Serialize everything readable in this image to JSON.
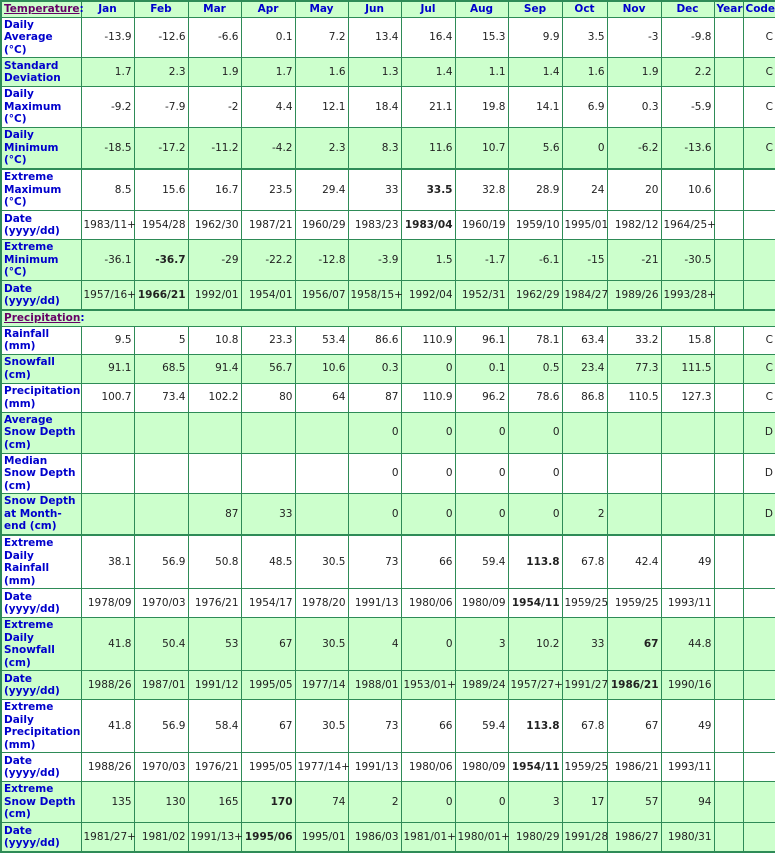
{
  "header": {
    "section_label": "Temperature",
    "months": [
      "Jan",
      "Feb",
      "Mar",
      "Apr",
      "May",
      "Jun",
      "Jul",
      "Aug",
      "Sep",
      "Oct",
      "Nov",
      "Dec"
    ],
    "year_label": "Year",
    "code_label": "Code"
  },
  "precip_section_label": "Precipitation",
  "temperature_rows": [
    {
      "label": "Daily Average (°C)",
      "values": [
        "-13.9",
        "-12.6",
        "-6.6",
        "0.1",
        "7.2",
        "13.4",
        "16.4",
        "15.3",
        "9.9",
        "3.5",
        "-3",
        "-9.8"
      ],
      "year": "",
      "code": "C",
      "bold": []
    },
    {
      "label": "Standard Deviation",
      "values": [
        "1.7",
        "2.3",
        "1.9",
        "1.7",
        "1.6",
        "1.3",
        "1.4",
        "1.1",
        "1.4",
        "1.6",
        "1.9",
        "2.2"
      ],
      "year": "",
      "code": "C",
      "bold": []
    },
    {
      "label": "Daily Maximum (°C)",
      "values": [
        "-9.2",
        "-7.9",
        "-2",
        "4.4",
        "12.1",
        "18.4",
        "21.1",
        "19.8",
        "14.1",
        "6.9",
        "0.3",
        "-5.9"
      ],
      "year": "",
      "code": "C",
      "bold": []
    },
    {
      "label": "Daily Minimum (°C)",
      "values": [
        "-18.5",
        "-17.2",
        "-11.2",
        "-4.2",
        "2.3",
        "8.3",
        "11.6",
        "10.7",
        "5.6",
        "0",
        "-6.2",
        "-13.6"
      ],
      "year": "",
      "code": "C",
      "bold": []
    },
    {
      "label": "Extreme Maximum (°C)",
      "values": [
        "8.5",
        "15.6",
        "16.7",
        "23.5",
        "29.4",
        "33",
        "33.5",
        "32.8",
        "28.9",
        "24",
        "20",
        "10.6"
      ],
      "year": "",
      "code": "",
      "bold": [
        6
      ]
    },
    {
      "label": "Date (yyyy/dd)",
      "values": [
        "1983/11+",
        "1954/28",
        "1962/30",
        "1987/21",
        "1960/29",
        "1983/23",
        "1983/04",
        "1960/19",
        "1959/10",
        "1995/01",
        "1982/12",
        "1964/25+"
      ],
      "year": "",
      "code": "",
      "bold": [
        6
      ]
    },
    {
      "label": "Extreme Minimum (°C)",
      "values": [
        "-36.1",
        "-36.7",
        "-29",
        "-22.2",
        "-12.8",
        "-3.9",
        "1.5",
        "-1.7",
        "-6.1",
        "-15",
        "-21",
        "-30.5"
      ],
      "year": "",
      "code": "",
      "bold": [
        1
      ]
    },
    {
      "label": "Date (yyyy/dd)",
      "values": [
        "1957/16+",
        "1966/21",
        "1992/01",
        "1954/01",
        "1956/07",
        "1958/15+",
        "1992/04",
        "1952/31",
        "1962/29",
        "1984/27",
        "1989/26",
        "1993/28+"
      ],
      "year": "",
      "code": "",
      "bold": [
        1
      ]
    }
  ],
  "precipitation_rows": [
    {
      "label": "Rainfall (mm)",
      "values": [
        "9.5",
        "5",
        "10.8",
        "23.3",
        "53.4",
        "86.6",
        "110.9",
        "96.1",
        "78.1",
        "63.4",
        "33.2",
        "15.8"
      ],
      "year": "",
      "code": "C",
      "bold": []
    },
    {
      "label": "Snowfall (cm)",
      "values": [
        "91.1",
        "68.5",
        "91.4",
        "56.7",
        "10.6",
        "0.3",
        "0",
        "0.1",
        "0.5",
        "23.4",
        "77.3",
        "111.5"
      ],
      "year": "",
      "code": "C",
      "bold": []
    },
    {
      "label": "Precipitation (mm)",
      "values": [
        "100.7",
        "73.4",
        "102.2",
        "80",
        "64",
        "87",
        "110.9",
        "96.2",
        "78.6",
        "86.8",
        "110.5",
        "127.3"
      ],
      "year": "",
      "code": "C",
      "bold": []
    },
    {
      "label": "Average Snow Depth (cm)",
      "values": [
        "",
        "",
        "",
        "",
        "",
        "0",
        "0",
        "0",
        "0",
        "",
        "",
        ""
      ],
      "year": "",
      "code": "D",
      "bold": []
    },
    {
      "label": "Median Snow Depth (cm)",
      "values": [
        "",
        "",
        "",
        "",
        "",
        "0",
        "0",
        "0",
        "0",
        "",
        "",
        ""
      ],
      "year": "",
      "code": "D",
      "bold": []
    },
    {
      "label": "Snow Depth at Month-end (cm)",
      "values": [
        "",
        "",
        "87",
        "33",
        "",
        "0",
        "0",
        "0",
        "0",
        "2",
        "",
        ""
      ],
      "year": "",
      "code": "D",
      "bold": []
    },
    {
      "label": "Extreme Daily Rainfall (mm)",
      "values": [
        "38.1",
        "56.9",
        "50.8",
        "48.5",
        "30.5",
        "73",
        "66",
        "59.4",
        "113.8",
        "67.8",
        "42.4",
        "49"
      ],
      "year": "",
      "code": "",
      "bold": [
        8
      ]
    },
    {
      "label": "Date (yyyy/dd)",
      "values": [
        "1978/09",
        "1970/03",
        "1976/21",
        "1954/17",
        "1978/20",
        "1991/13",
        "1980/06",
        "1980/09",
        "1954/11",
        "1959/25",
        "1959/25",
        "1993/11"
      ],
      "year": "",
      "code": "",
      "bold": [
        8
      ]
    },
    {
      "label": "Extreme Daily Snowfall (cm)",
      "values": [
        "41.8",
        "50.4",
        "53",
        "67",
        "30.5",
        "4",
        "0",
        "3",
        "10.2",
        "33",
        "67",
        "44.8"
      ],
      "year": "",
      "code": "",
      "bold": [
        10
      ]
    },
    {
      "label": "Date (yyyy/dd)",
      "values": [
        "1988/26",
        "1987/01",
        "1991/12",
        "1995/05",
        "1977/14",
        "1988/01",
        "1953/01+",
        "1989/24",
        "1957/27+",
        "1991/27",
        "1986/21",
        "1990/16"
      ],
      "year": "",
      "code": "",
      "bold": [
        10
      ]
    },
    {
      "label": "Extreme Daily Precipitation (mm)",
      "values": [
        "41.8",
        "56.9",
        "58.4",
        "67",
        "30.5",
        "73",
        "66",
        "59.4",
        "113.8",
        "67.8",
        "67",
        "49"
      ],
      "year": "",
      "code": "",
      "bold": [
        8
      ]
    },
    {
      "label": "Date (yyyy/dd)",
      "values": [
        "1988/26",
        "1970/03",
        "1976/21",
        "1995/05",
        "1977/14+",
        "1991/13",
        "1980/06",
        "1980/09",
        "1954/11",
        "1959/25",
        "1986/21",
        "1993/11"
      ],
      "year": "",
      "code": "",
      "bold": [
        8
      ]
    },
    {
      "label": "Extreme Snow Depth (cm)",
      "values": [
        "135",
        "130",
        "165",
        "170",
        "74",
        "2",
        "0",
        "0",
        "3",
        "17",
        "57",
        "94"
      ],
      "year": "",
      "code": "",
      "bold": [
        3
      ]
    },
    {
      "label": "Date (yyyy/dd)",
      "values": [
        "1981/27+",
        "1981/02",
        "1991/13+",
        "1995/06",
        "1995/01",
        "1986/03",
        "1981/01+",
        "1980/01+",
        "1980/29",
        "1991/28",
        "1986/27",
        "1980/31"
      ],
      "year": "",
      "code": "",
      "bold": [
        3
      ]
    }
  ],
  "colors": {
    "border": "#2e8b57",
    "green_row": "#ccffcc",
    "label_text": "#0000cc",
    "section_link": "#660066"
  }
}
